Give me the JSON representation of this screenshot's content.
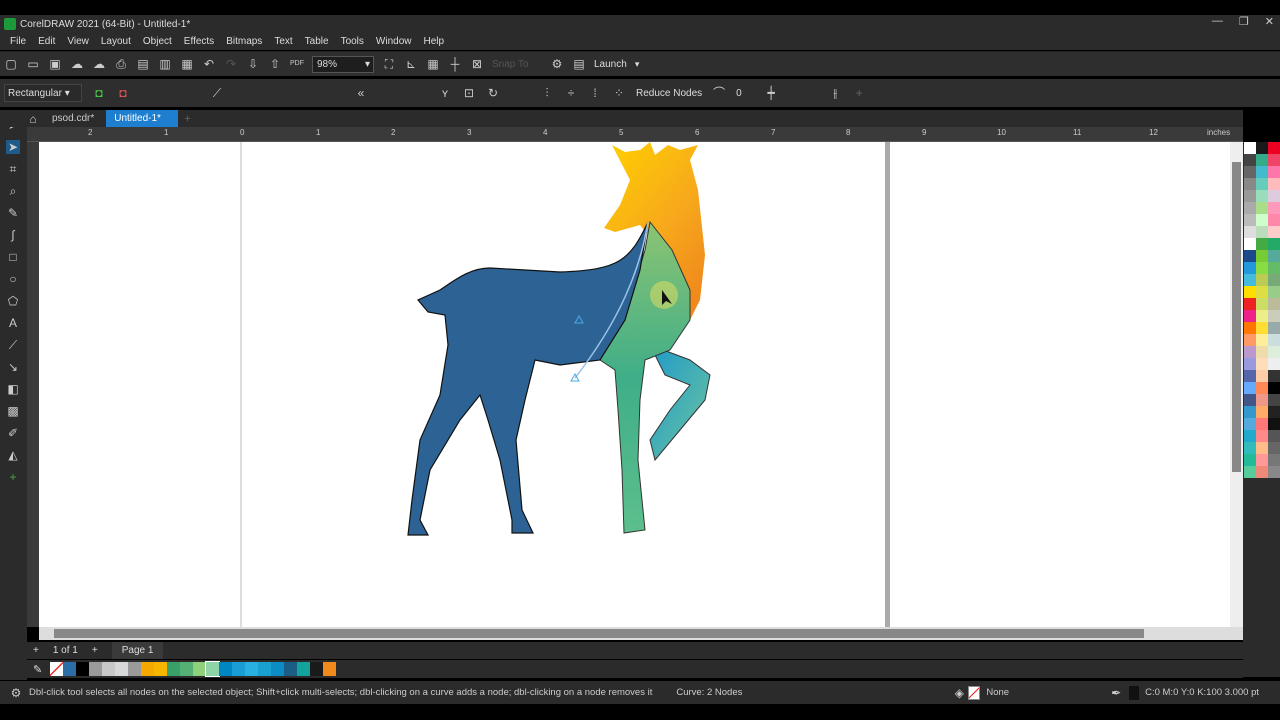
{
  "window": {
    "title": "CorelDRAW 2021 (64-Bit) - Untitled-1*"
  },
  "menu": [
    "File",
    "Edit",
    "View",
    "Layout",
    "Object",
    "Effects",
    "Bitmaps",
    "Text",
    "Table",
    "Tools",
    "Window",
    "Help"
  ],
  "toolbar": {
    "zoom": "98%",
    "snap_to": "Snap To",
    "launch": "Launch"
  },
  "propbar": {
    "selection_mode": "Rectangular",
    "reduce_nodes": "Reduce Nodes",
    "smoothness": "0"
  },
  "tabs": [
    {
      "label": "psod.cdr*"
    },
    {
      "label": "Untitled-1*"
    }
  ],
  "ruler": {
    "labels": [
      "2",
      "1",
      "0",
      "1",
      "2",
      "3",
      "4",
      "5",
      "6",
      "7",
      "8",
      "9",
      "10",
      "11",
      "12"
    ],
    "unit": "inches"
  },
  "pages": {
    "count": "1 of 1",
    "current": "Page 1"
  },
  "doc_palette": [
    "#ffffff",
    "#2d6da5",
    "#000000",
    "#9a9a9a",
    "#c8c8c8",
    "#d8d8d8",
    "#9a9a9a",
    "#f5a800",
    "#f7b500",
    "#3aa06a",
    "#55b075",
    "#8fd07a",
    "#8fd3a8",
    "#0086c3",
    "#1a9dd5",
    "#27b0e0",
    "#1aa0d0",
    "#0b8cc4",
    "#1c5d86",
    "#13a39c",
    "#1a1a1a",
    "#f08a1c"
  ],
  "status": {
    "hint": "Dbl-click tool selects all nodes on the selected object; Shift+click multi-selects; dbl-clicking on a curve adds a node; dbl-clicking on a node removes it",
    "object": "Curve: 2 Nodes",
    "fill": "None",
    "outline": "C:0 M:0 Y:0 K:100  3.000 pt"
  },
  "colors": {
    "accent": "#1e7fd0",
    "deer_body": "#2d6394"
  }
}
